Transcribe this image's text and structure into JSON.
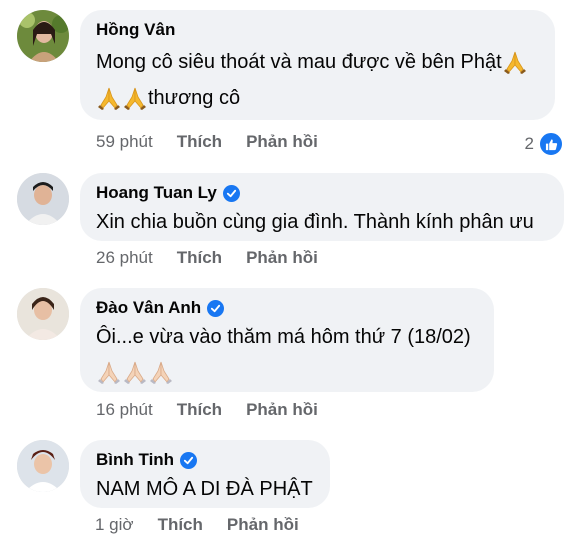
{
  "comments": [
    {
      "name": "Hồng Vân",
      "verified": false,
      "lines": [
        "Mong cô siêu thoát và mau được về bên Phật",
        "thương cô"
      ],
      "time": "59 phút",
      "like": "Thích",
      "reply": "Phản hồi",
      "reactions": "2"
    },
    {
      "name": "Hoang Tuan Ly",
      "verified": true,
      "lines": [
        "Xin chia buồn cùng gia đình. Thành kính phân ưu"
      ],
      "time": "26 phút",
      "like": "Thích",
      "reply": "Phản hồi"
    },
    {
      "name": "Đào Vân Anh",
      "verified": true,
      "lines": [
        "Ôi...e vừa vào thăm má hôm thứ 7 (18/02)"
      ],
      "time": "16 phút",
      "like": "Thích",
      "reply": "Phản hồi"
    },
    {
      "name": "Bình Tinh",
      "verified": true,
      "lines": [
        "NAM MÔ A DI ĐÀ PHẬT"
      ],
      "time": "1 giờ",
      "like": "Thích",
      "reply": "Phản hồi"
    }
  ],
  "colors": {
    "bubble": "#f0f2f5",
    "meta_text": "#65676b",
    "verified_blue": "#1877f2",
    "pray_yellow": "#f5b82e",
    "pray_light": "#f4d3b8"
  },
  "icons": {
    "verified": "verified-badge-icon",
    "pray": "folded-hands-emoji-icon",
    "like": "thumbs-up-icon"
  }
}
